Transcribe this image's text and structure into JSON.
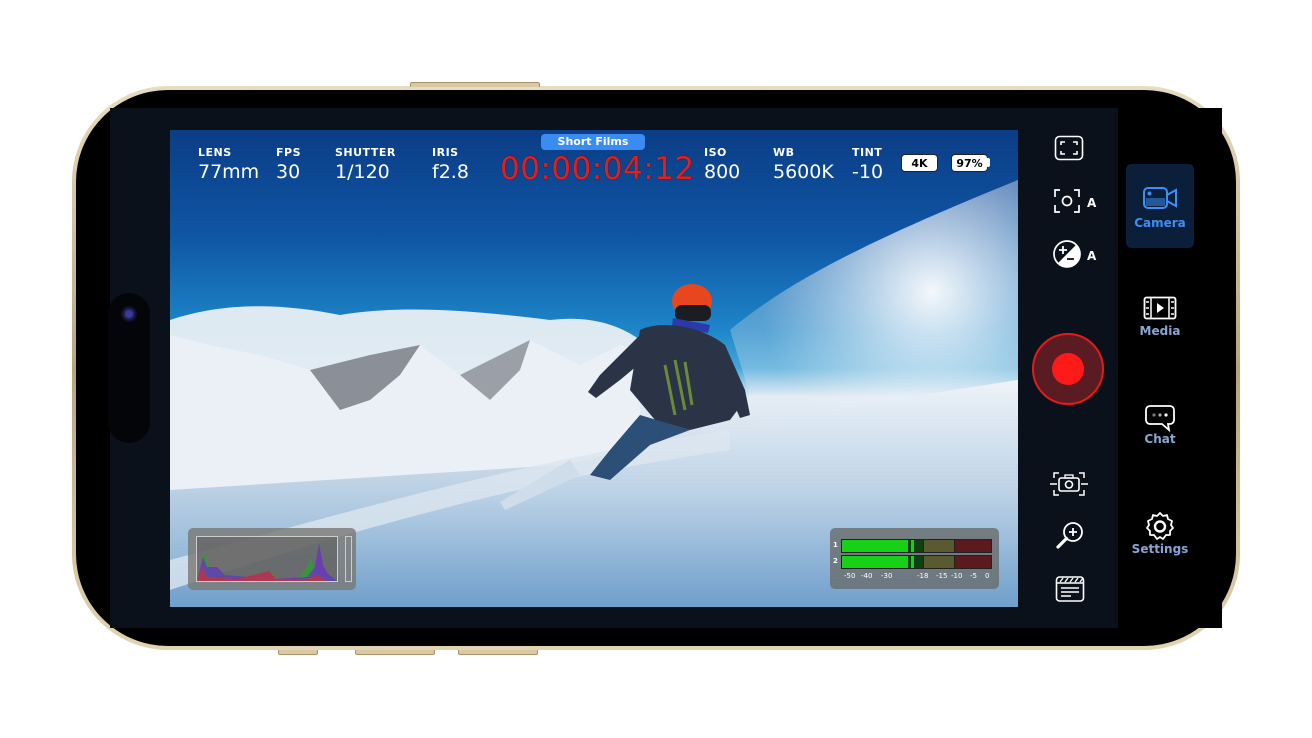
{
  "hud": {
    "lens": {
      "label": "LENS",
      "value": "77mm"
    },
    "fps": {
      "label": "FPS",
      "value": "30"
    },
    "shutter": {
      "label": "SHUTTER",
      "value": "1/120"
    },
    "iris": {
      "label": "IRIS",
      "value": "f2.8"
    },
    "project": "Short Films",
    "timecode": "00:00:04:12",
    "iso": {
      "label": "ISO",
      "value": "800"
    },
    "wb": {
      "label": "WB",
      "value": "5600K"
    },
    "tint": {
      "label": "TINT",
      "value": "-10"
    },
    "resolution": "4K",
    "battery": "97%"
  },
  "audio_meter": {
    "channels": [
      "1",
      "2"
    ],
    "scale": [
      "-50",
      "-40",
      "-30",
      "-18",
      "-15",
      "-10",
      "-5",
      "0"
    ]
  },
  "tools": {
    "frame_guides": "frame-guides-icon",
    "auto_focus": {
      "icon": "auto-focus-icon",
      "suffix": "A"
    },
    "auto_exposure": {
      "icon": "auto-exposure-icon",
      "suffix": "A"
    },
    "record": "record-button",
    "stabilization": "camera-stabilization-icon",
    "zoom": "zoom-in-icon",
    "slate": "slate-icon"
  },
  "nav": [
    {
      "label": "Camera",
      "icon": "video-camera-icon",
      "active": true
    },
    {
      "label": "Media",
      "icon": "film-play-icon",
      "active": false
    },
    {
      "label": "Chat",
      "icon": "chat-bubble-icon",
      "active": false
    },
    {
      "label": "Settings",
      "icon": "gear-icon",
      "active": false
    }
  ],
  "colors": {
    "accent": "#3d8ff5",
    "timecode": "#e0201e",
    "record": "#ff1a1a",
    "project_tag": "#3a8cf0"
  }
}
